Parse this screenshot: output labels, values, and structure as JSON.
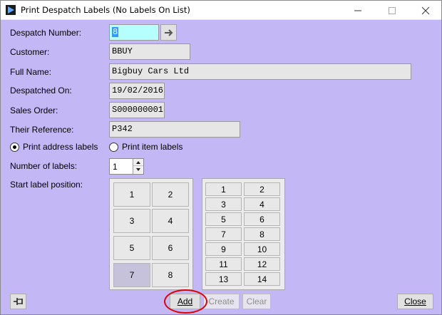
{
  "window": {
    "title": "Print Despatch Labels (No Labels On List)",
    "icon": "play-arrow-icon"
  },
  "form": {
    "despatch_number": {
      "label": "Despatch Number:",
      "value": "8"
    },
    "customer": {
      "label": "Customer:",
      "value": "BBUY"
    },
    "full_name": {
      "label": "Full Name:",
      "value": "Bigbuy Cars Ltd"
    },
    "despatched_on": {
      "label": "Despatched On:",
      "value": "19/02/2016"
    },
    "sales_order": {
      "label": "Sales Order:",
      "value": "S000000001"
    },
    "their_reference": {
      "label": "Their Reference:",
      "value": "P342"
    }
  },
  "label_type": {
    "options": [
      {
        "label": "Print address labels",
        "selected": true
      },
      {
        "label": "Print item labels",
        "selected": false
      }
    ]
  },
  "number_of_labels": {
    "label": "Number of labels:",
    "value": "1"
  },
  "start_position": {
    "label": "Start label position:",
    "grid_a": [
      "1",
      "2",
      "3",
      "4",
      "5",
      "6",
      "7",
      "8"
    ],
    "grid_a_selected": "7",
    "grid_b": [
      "1",
      "2",
      "3",
      "4",
      "5",
      "6",
      "7",
      "8",
      "9",
      "10",
      "11",
      "12",
      "13",
      "14"
    ]
  },
  "buttons": {
    "add": {
      "label": "Add",
      "enabled": true
    },
    "create": {
      "label": "Create",
      "enabled": false
    },
    "clear": {
      "label": "Clear",
      "enabled": false
    },
    "close": {
      "label": "Close",
      "enabled": true
    }
  },
  "colors": {
    "form_background": "#c3b7f5",
    "active_field": "#b6ffff",
    "annotation_ring": "#e00000"
  }
}
